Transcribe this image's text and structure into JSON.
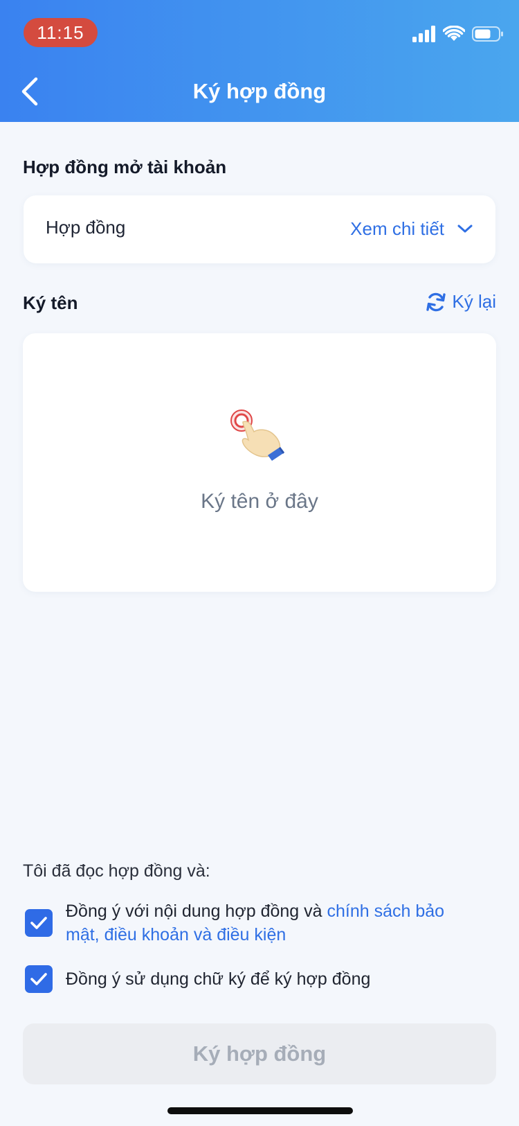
{
  "status_bar": {
    "time": "11:15",
    "icons": [
      "signal-icon",
      "wifi-icon",
      "battery-icon"
    ]
  },
  "header": {
    "title": "Ký hợp đồng",
    "back_icon": "chevron-left-icon"
  },
  "contract_section": {
    "title": "Hợp đồng mở tài khoản",
    "card_label": "Hợp đồng",
    "detail_link": "Xem chi tiết",
    "detail_icon": "chevron-down-icon"
  },
  "signature_section": {
    "title": "Ký tên",
    "resign_label": "Ký lại",
    "resign_icon": "refresh-icon",
    "placeholder": "Ký tên ở đây",
    "placeholder_icon": "tap-hand-icon"
  },
  "agreement": {
    "intro": "Tôi đã đọc hợp đồng và:",
    "items": [
      {
        "text": " Đồng ý với nội dung hợp đồng và ",
        "link_text": "chính sách bảo mật, điều khoản và điều kiện",
        "checked": true
      },
      {
        "text": "Đồng ý sử dụng chữ ký để ký hợp đồng",
        "checked": true
      }
    ]
  },
  "submit_button": {
    "label": "Ký hợp đồng",
    "enabled": false
  },
  "colors": {
    "header_start": "#3a82f0",
    "header_end": "#4aa6ee",
    "accent": "#2f6fe4",
    "checkbox": "#2f6be6",
    "time_pill": "#d44b3f",
    "background": "#f4f7fc",
    "disabled_button": "#ebedf1"
  }
}
